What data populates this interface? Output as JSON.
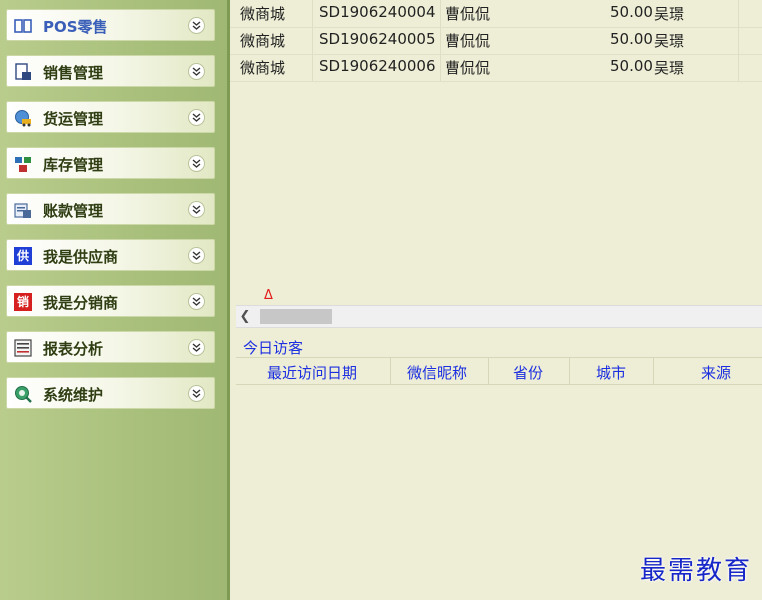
{
  "sidebar": {
    "items": [
      {
        "label": "POS零售",
        "icon": "pos-grid-icon"
      },
      {
        "label": "销售管理",
        "icon": "sales-doc-icon"
      },
      {
        "label": "货运管理",
        "icon": "truck-globe-icon"
      },
      {
        "label": "库存管理",
        "icon": "inventory-boxes-icon"
      },
      {
        "label": "账款管理",
        "icon": "ledger-icon"
      },
      {
        "label": "我是供应商",
        "icon": "supplier-badge-icon",
        "badge": "供"
      },
      {
        "label": "我是分销商",
        "icon": "distributor-badge-icon",
        "badge": "销"
      },
      {
        "label": "报表分析",
        "icon": "report-chart-icon"
      },
      {
        "label": "系统维护",
        "icon": "system-search-icon"
      }
    ]
  },
  "orders": {
    "rows": [
      {
        "source": "微商城",
        "order_no": "SD1906240004",
        "customer": "曹侃侃",
        "amount": "50.00",
        "operator": "吴璟"
      },
      {
        "source": "微商城",
        "order_no": "SD1906240005",
        "customer": "曹侃侃",
        "amount": "50.00",
        "operator": "吴璟"
      },
      {
        "source": "微商城",
        "order_no": "SD1906240006",
        "customer": "曹侃侃",
        "amount": "50.00",
        "operator": "吴璟"
      }
    ],
    "warning_mark": "Δ"
  },
  "visitors": {
    "title": "今日访客",
    "columns": [
      "最近访问日期",
      "微信昵称",
      "省份",
      "城市",
      "来源"
    ]
  },
  "watermark": "最需教育",
  "colors": {
    "sidebar_bg": "#a9c07c",
    "nav_text": "#2f3d12",
    "link_blue": "#1b2ee0",
    "content_bg": "#eeeed6",
    "warning_red": "#e21b1b",
    "supplier_badge": "#1f3fd6",
    "distributor_badge": "#d62020"
  }
}
